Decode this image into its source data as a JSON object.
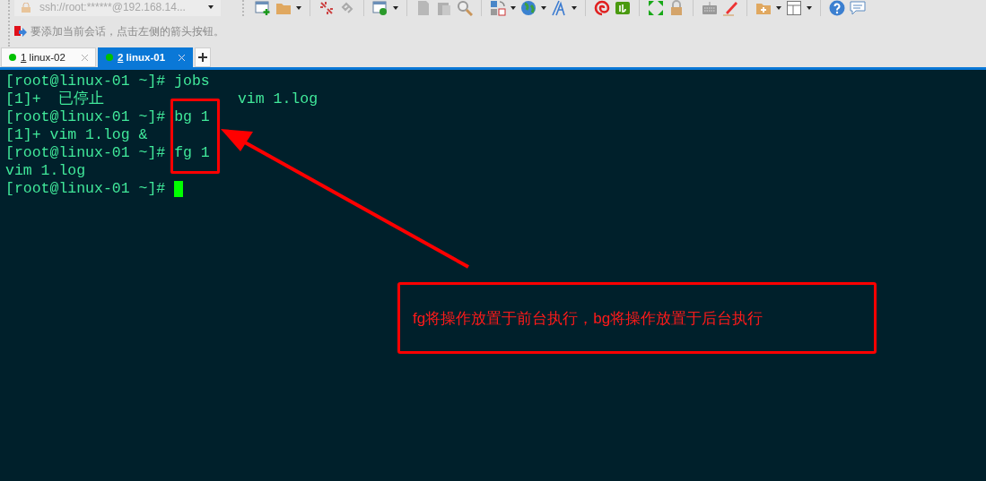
{
  "toolbar": {
    "address": "ssh://root:******@192.168.14...",
    "tip": "要添加当前会话，点击左侧的箭头按钮。"
  },
  "tabs": [
    {
      "hotkey": "1",
      "label": "linux-02",
      "selected": false,
      "connected": true
    },
    {
      "hotkey": "2",
      "label": "linux-01",
      "selected": true,
      "connected": true
    }
  ],
  "terminal": {
    "lines": [
      "[root@linux-01 ~]# jobs",
      "[1]+  已停止               vim 1.log",
      "[root@linux-01 ~]# bg 1",
      "[1]+ vim 1.log &",
      "[root@linux-01 ~]# fg 1",
      "vim 1.log",
      "[root@linux-01 ~]# "
    ]
  },
  "annotation": {
    "callout": "fg将操作放置于前台执行，bg将操作放置于后台执行"
  }
}
